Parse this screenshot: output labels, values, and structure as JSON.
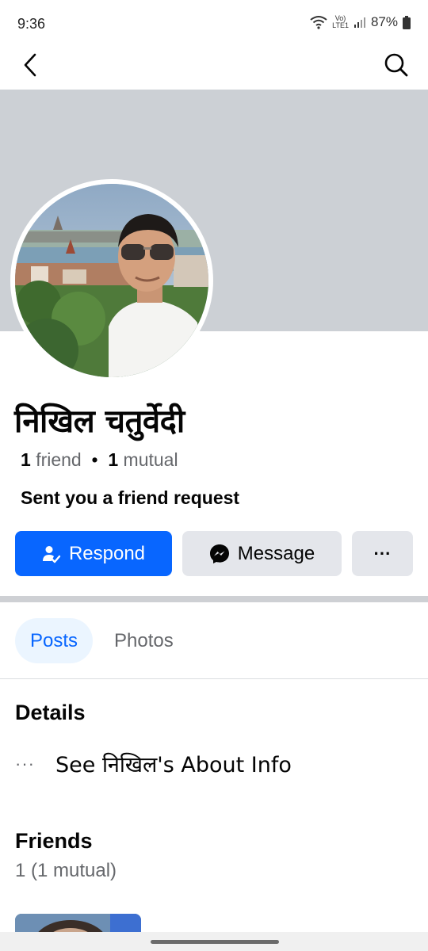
{
  "status": {
    "time": "9:36",
    "network_top": "Vo)",
    "network_bottom": "LTE1",
    "battery": "87%"
  },
  "profile": {
    "name": "निखिल चतुर्वेदी",
    "friends_count": "1",
    "friends_word": "friend",
    "separator": "•",
    "mutual_count": "1",
    "mutual_word": "mutual",
    "request_text": "Sent you a friend request"
  },
  "actions": {
    "respond_label": "Respond",
    "message_label": "Message",
    "more_label": "···"
  },
  "tabs": [
    {
      "label": "Posts",
      "active": true
    },
    {
      "label": "Photos",
      "active": false
    }
  ],
  "details": {
    "title": "Details",
    "about_dots": "···",
    "about_text": "See निखिल's About Info"
  },
  "friends": {
    "title": "Friends",
    "count_text": "1 (1 mutual)"
  },
  "colors": {
    "brand_blue": "#0866ff",
    "cover_gray": "#ccd0d5",
    "button_gray": "#e4e6eb"
  }
}
